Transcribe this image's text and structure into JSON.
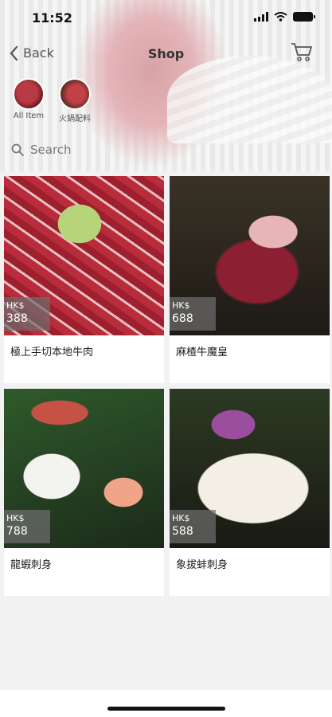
{
  "status": {
    "time": "11:52"
  },
  "nav": {
    "back_label": "Back",
    "title": "Shop"
  },
  "categories": [
    {
      "label": "All Item"
    },
    {
      "label": "火鍋配料"
    }
  ],
  "search": {
    "placeholder": "Search"
  },
  "currency": "HK$",
  "products": [
    {
      "name": "極上手切本地牛肉",
      "price": "388"
    },
    {
      "name": "麻楂牛魔皇",
      "price": "688"
    },
    {
      "name": "龍蝦刺身",
      "price": "788"
    },
    {
      "name": "象拔蚌刺身",
      "price": "588"
    }
  ]
}
